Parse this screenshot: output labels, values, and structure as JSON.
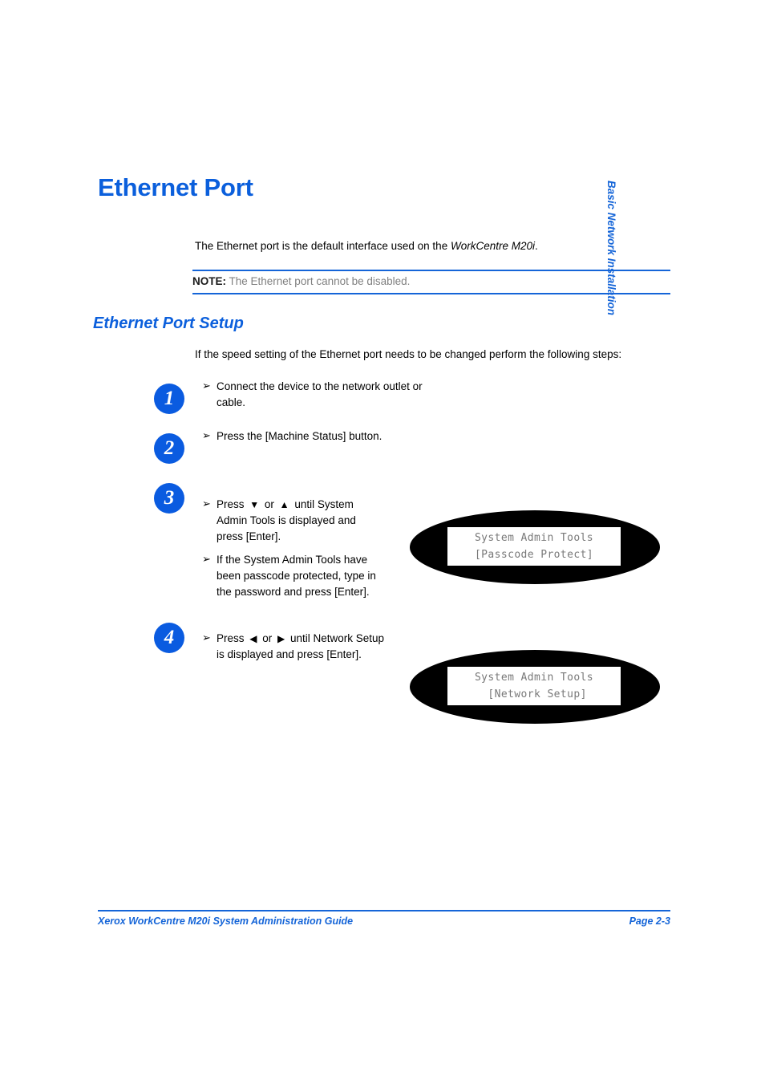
{
  "document": {
    "title": "Ethernet Port",
    "intro_before_italic": "The Ethernet port is the default interface used on the ",
    "intro_italic": "WorkCentre M20i",
    "intro_after_italic": ".",
    "note_label": "NOTE:",
    "note_text": " The Ethernet port cannot be disabled.",
    "section_heading": "Ethernet Port Setup",
    "lead_in": "If the speed setting of the Ethernet port needs to be changed perform the following steps:"
  },
  "side_tab": {
    "label": "Basic Network Installation"
  },
  "bullet_glyph": "➢",
  "steps": [
    {
      "number": "1",
      "bullets": [
        {
          "text": "Connect the device to the network outlet or cable."
        }
      ]
    },
    {
      "number": "2",
      "bullets": [
        {
          "text": "Press the [Machine Status] button."
        }
      ]
    },
    {
      "number": "3",
      "bullets": [
        {
          "pre": "Press ",
          "arrow1": "▼",
          "mid": " or ",
          "arrow2": "▲",
          "post": " until System Admin Tools is displayed and press [Enter]."
        },
        {
          "text": "If the System Admin Tools have been passcode protected, type in the password and press [Enter]."
        }
      ]
    },
    {
      "number": "4",
      "bullets": [
        {
          "pre": "Press ",
          "arrow1": "◀",
          "mid": " or ",
          "arrow2": "▶",
          "post": " until Network Setup is displayed and press [Enter]."
        }
      ]
    }
  ],
  "displays": [
    {
      "line1": "System Admin Tools",
      "line2": "[Passcode Protect]"
    },
    {
      "line1": "System Admin Tools",
      "line2": " [Network Setup]"
    }
  ],
  "footer": {
    "left": "Xerox WorkCentre M20i System Administration Guide",
    "right": "Page 2-3"
  },
  "colors": {
    "brand_blue": "#0B5FDC",
    "rule_blue": "#1565D8",
    "note_gray": "#808080",
    "lcd_text": "#787878"
  }
}
